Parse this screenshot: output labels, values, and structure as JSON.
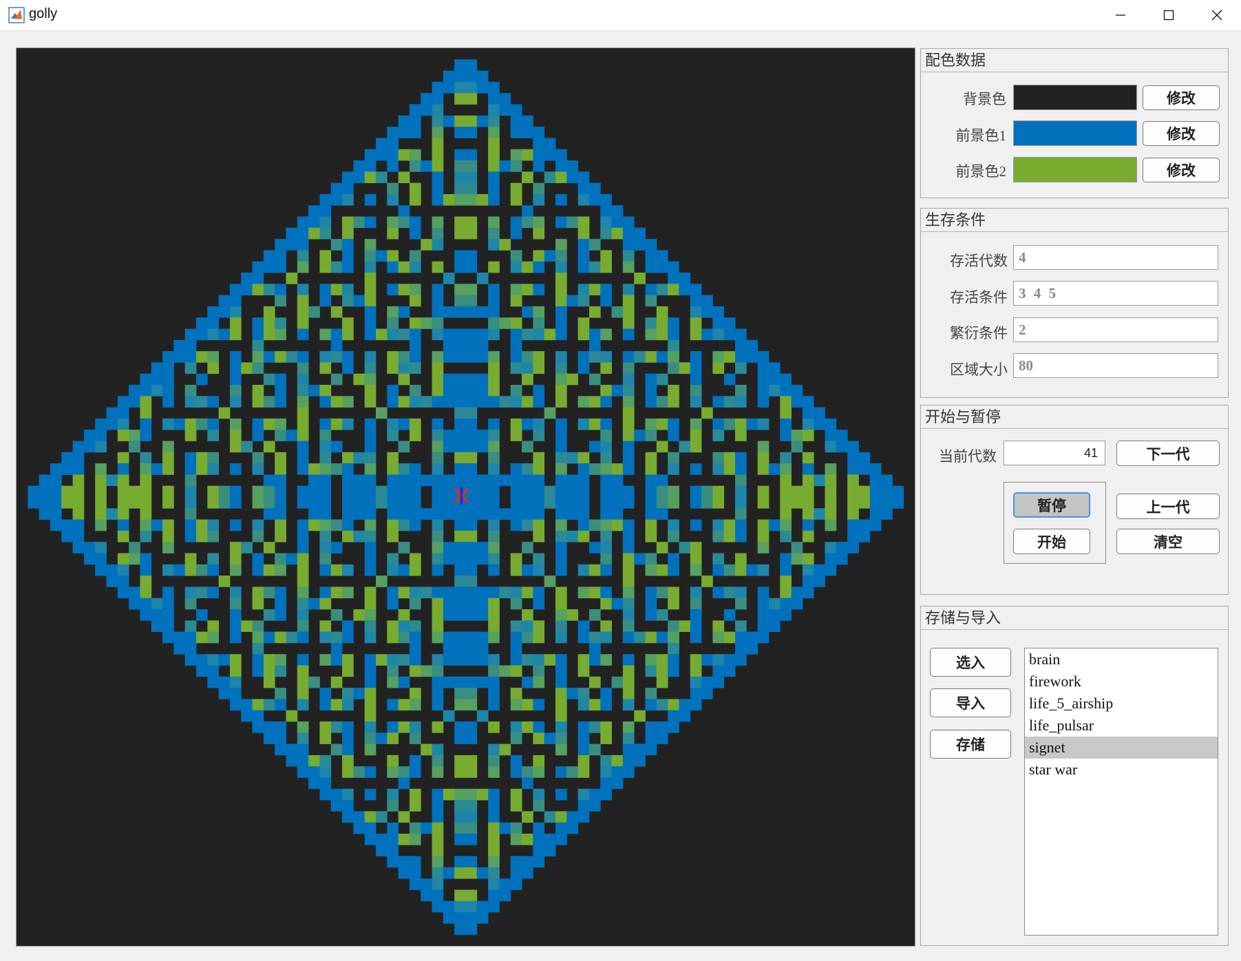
{
  "window": {
    "title": "golly"
  },
  "board": {
    "cells": 80,
    "colors": {
      "background": "#222222",
      "fg1": "#0072BD",
      "fg2": "#77AC30"
    },
    "marker": "×"
  },
  "color_panel": {
    "title": "配色数据",
    "rows": [
      {
        "label": "背景色",
        "color": "#222222",
        "button": "修改"
      },
      {
        "label": "前景色1",
        "color": "#0072BD",
        "button": "修改"
      },
      {
        "label": "前景色2",
        "color": "#77AC30",
        "button": "修改"
      }
    ]
  },
  "survival_panel": {
    "title": "生存条件",
    "fields": [
      {
        "label": "存活代数",
        "value": "4"
      },
      {
        "label": "存活条件",
        "value": "3 4 5"
      },
      {
        "label": "繁衍条件",
        "value": "2"
      },
      {
        "label": "区域大小",
        "value": "80"
      }
    ]
  },
  "run_panel": {
    "title": "开始与暂停",
    "current_gen_label": "当前代数",
    "current_gen_value": "41",
    "next_button": "下一代",
    "pause_button": "暂停",
    "prev_button": "上一代",
    "start_button": "开始",
    "clear_button": "清空"
  },
  "storage_panel": {
    "title": "存储与导入",
    "select_button": "选入",
    "import_button": "导入",
    "save_button": "存储",
    "items": [
      "brain",
      "firework",
      "life_5_airship",
      "life_pulsar",
      "signet",
      "star war"
    ],
    "selected": "signet"
  }
}
